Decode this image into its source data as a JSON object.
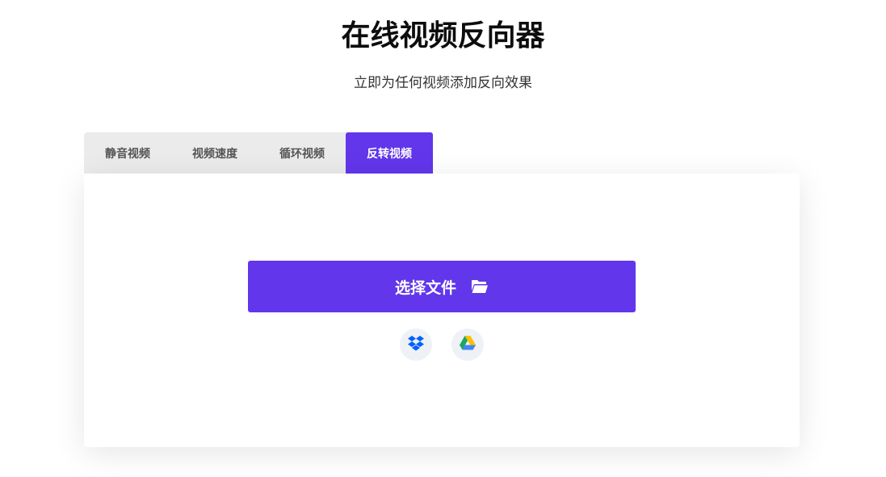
{
  "theme": {
    "accent": "#6236ea"
  },
  "header": {
    "title": "在线视频反向器",
    "subtitle": "立即为任何视频添加反向效果"
  },
  "tabs": [
    {
      "label": "静音视频",
      "active": false
    },
    {
      "label": "视频速度",
      "active": false
    },
    {
      "label": "循环视频",
      "active": false
    },
    {
      "label": "反转视频",
      "active": true
    }
  ],
  "upload": {
    "button_label": "选择文件",
    "button_icon": "folder-open-icon",
    "cloud_sources": [
      {
        "icon": "dropbox-icon"
      },
      {
        "icon": "google-drive-icon"
      }
    ]
  }
}
